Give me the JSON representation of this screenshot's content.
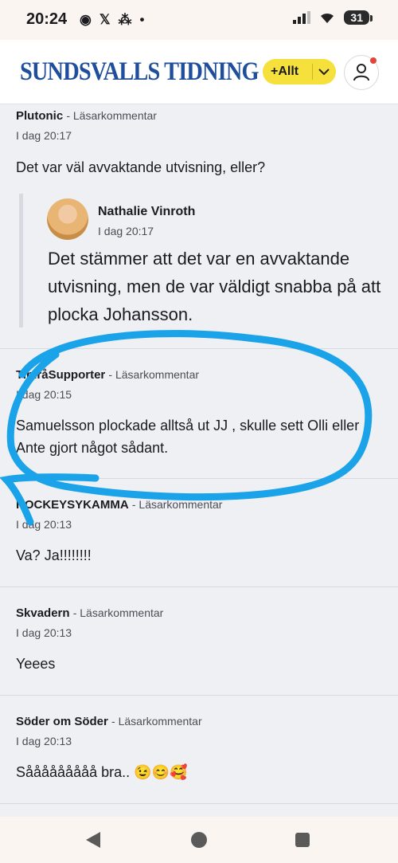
{
  "status_bar": {
    "time": "20:24",
    "battery": "31"
  },
  "header": {
    "logo": "SUNDSVALLS TIDNING",
    "plus_label": "+Allt"
  },
  "main_thread": {
    "author": "Plutonic",
    "kind": "- Läsarkommentar",
    "time": "I dag 20:17",
    "body": "Det var väl avvaktande utvisning, eller?",
    "reply": {
      "author": "Nathalie Vinroth",
      "time": "I dag 20:17",
      "body": "Det stämmer att det var en avvaktande utvisning, men de var väldigt snabba på att plocka Johansson."
    }
  },
  "comments": [
    {
      "author": "TimråSupporter",
      "kind": "- Läsarkommentar",
      "time": "I dag 20:15",
      "body": "Samuelsson plockade alltså ut JJ , skulle sett Olli eller Ante gjort något sådant."
    },
    {
      "author": "HOCKEYSYKAMMA",
      "kind": "- Läsarkommentar",
      "time": "I dag 20:13",
      "body": "Va? Ja!!!!!!!!"
    },
    {
      "author": "Skvadern",
      "kind": "- Läsarkommentar",
      "time": "I dag 20:13",
      "body": "Yeees"
    },
    {
      "author": "Söder om Söder",
      "kind": "- Läsarkommentar",
      "time": "I dag 20:13",
      "body": "Sååååååååå bra.. 😉😊🥰"
    }
  ],
  "colors": {
    "logo": "#1f4e9c",
    "accent": "#f5e03c",
    "annotation": "#1aa3e8"
  }
}
